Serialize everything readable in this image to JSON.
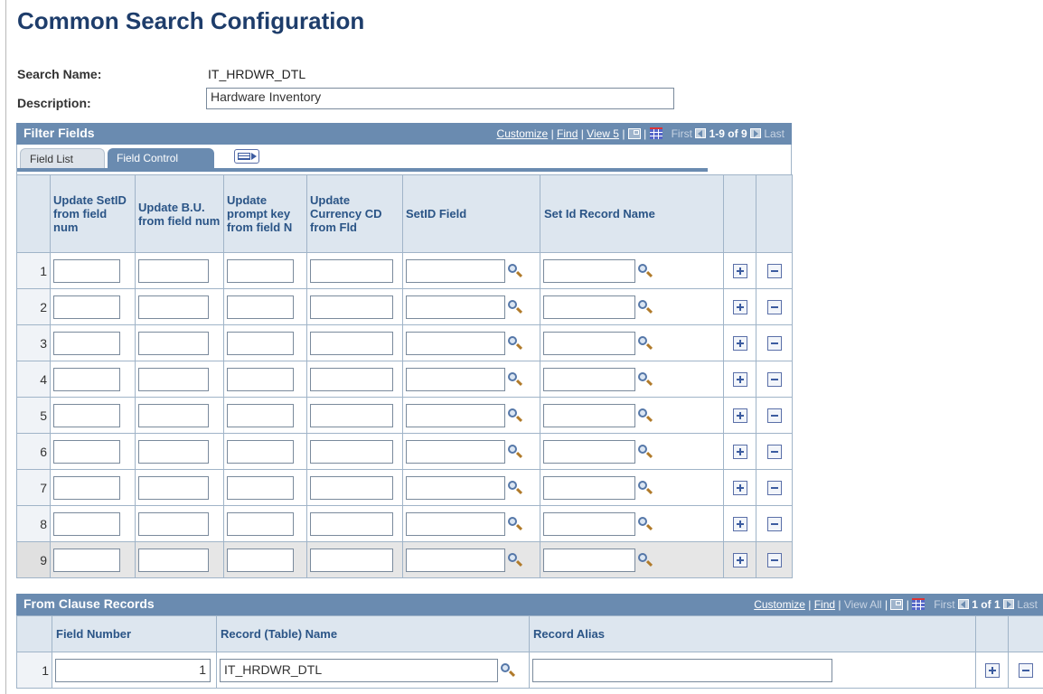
{
  "page": {
    "title": "Common Search Configuration",
    "search_name_label": "Search Name:",
    "search_name_value": "IT_HRDWR_DTL",
    "description_label": "Description:",
    "description_value": "Hardware Inventory"
  },
  "filter_fields": {
    "title": "Filter Fields",
    "nav": {
      "customize": "Customize",
      "find": "Find",
      "view": "View 5",
      "first": "First",
      "range": "1-9 of 9",
      "last": "Last"
    },
    "tabs": [
      {
        "label": "Field List",
        "active": false
      },
      {
        "label": "Field Control",
        "active": true
      }
    ],
    "columns": [
      "Update SetID from field num",
      "Update B.U. from field num",
      "Update prompt key from field N",
      "Update Currency CD from Fld",
      "SetID Field",
      "Set Id Record Name"
    ],
    "rows": [
      {
        "num": "1"
      },
      {
        "num": "2"
      },
      {
        "num": "3"
      },
      {
        "num": "4"
      },
      {
        "num": "5"
      },
      {
        "num": "6"
      },
      {
        "num": "7"
      },
      {
        "num": "8"
      },
      {
        "num": "9"
      }
    ]
  },
  "from_clause": {
    "title": "From Clause Records",
    "nav": {
      "customize": "Customize",
      "find": "Find",
      "view_all": "View All",
      "first": "First",
      "range": "1 of 1",
      "last": "Last"
    },
    "columns": [
      "Field Number",
      "Record (Table) Name",
      "Record Alias"
    ],
    "rows": [
      {
        "num": "1",
        "field_number": "1",
        "record_name": "IT_HRDWR_DTL",
        "record_alias": ""
      }
    ]
  },
  "colors": {
    "title": "#1e3d6b",
    "grid_header": "#6a8bb0",
    "column_header_bg": "#dde6ef",
    "column_header_text": "#2a5486"
  },
  "icons": [
    "lookup-icon",
    "add-row-icon",
    "delete-row-icon",
    "zoom-icon",
    "download-grid-icon",
    "show-all-columns-icon",
    "previous-icon",
    "next-icon"
  ]
}
